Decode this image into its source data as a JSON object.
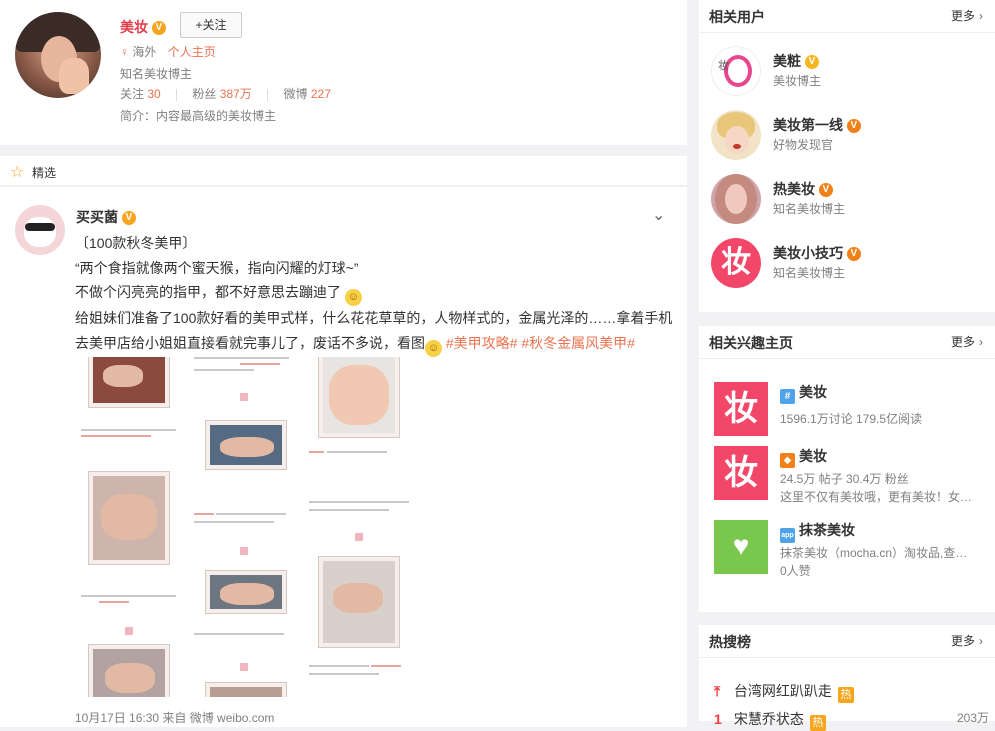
{
  "profile": {
    "name": "美妆",
    "follow_label": "+关注",
    "location": "海外",
    "homepage_link": "个人主页",
    "description": "知名美妆博主",
    "stats": [
      {
        "label": "关注",
        "value": "30"
      },
      {
        "label": "粉丝",
        "value": "387万"
      },
      {
        "label": "微博",
        "value": "227"
      }
    ],
    "intro": "简介：内容最高级的美妆博主"
  },
  "featured": {
    "label": "精选"
  },
  "post": {
    "author": "买买菌",
    "line1": "〔100款秋冬美甲〕",
    "line2": "“两个食指就像两个蜜天猴，指向闪耀的灯球~”",
    "line3": "不做个闪亮亮的指甲，都不好意思去蹦迪了",
    "line4": "给姐妹们准备了100款好看的美甲式样，什么花花草草的，人物样式的，金属光泽的……拿着手机",
    "line5": "去美甲店给小姐姐直接看就完事儿了，废话不多说，看图",
    "tag1": "#美甲攻略#",
    "tag2": "#秋冬金属风美甲#",
    "footer": "10月17日 16:30 来自 微博 weibo.com"
  },
  "related_users": {
    "title": "相关用户",
    "more": "更多",
    "items": [
      {
        "name": "美粧",
        "desc": "美妆博主",
        "badge": "gold"
      },
      {
        "name": "美妆第一线",
        "desc": "好物发现官",
        "badge": "orange"
      },
      {
        "name": "热美妆",
        "desc": "知名美妆博主",
        "badge": "orange"
      },
      {
        "name": "美妆小技巧",
        "desc": "知名美妆博主",
        "badge": "orange"
      }
    ]
  },
  "related_interests": {
    "title": "相关兴趣主页",
    "more": "更多",
    "items": [
      {
        "name": "美妆",
        "line1": "1596.1万讨论 179.5亿阅读",
        "line2": "",
        "line3": "",
        "thumb": "妆"
      },
      {
        "name": "美妆",
        "line1": "24.5万 帖子 30.4万 粉丝",
        "line2": "这里不仅有美妆哦，更有美妆！女…",
        "line3": "",
        "thumb": "妆"
      },
      {
        "name": "抹茶美妆",
        "line1": "抹茶美妆（mocha.cn）淘妆品,查…",
        "line2": "0人赞",
        "line3": "",
        "thumb": ""
      }
    ]
  },
  "hot_search": {
    "title": "热搜榜",
    "more": "更多",
    "items": [
      {
        "rank": "",
        "text": "台湾网红趴趴走",
        "tag": "热",
        "count": ""
      },
      {
        "rank": "1",
        "text": "宋慧乔状态",
        "tag": "热",
        "count": "203万"
      }
    ]
  },
  "colors": {
    "accent": "#eb7350",
    "brand_red": "#e33d4b",
    "pink": "#f3476a",
    "green": "#7ac74e"
  }
}
